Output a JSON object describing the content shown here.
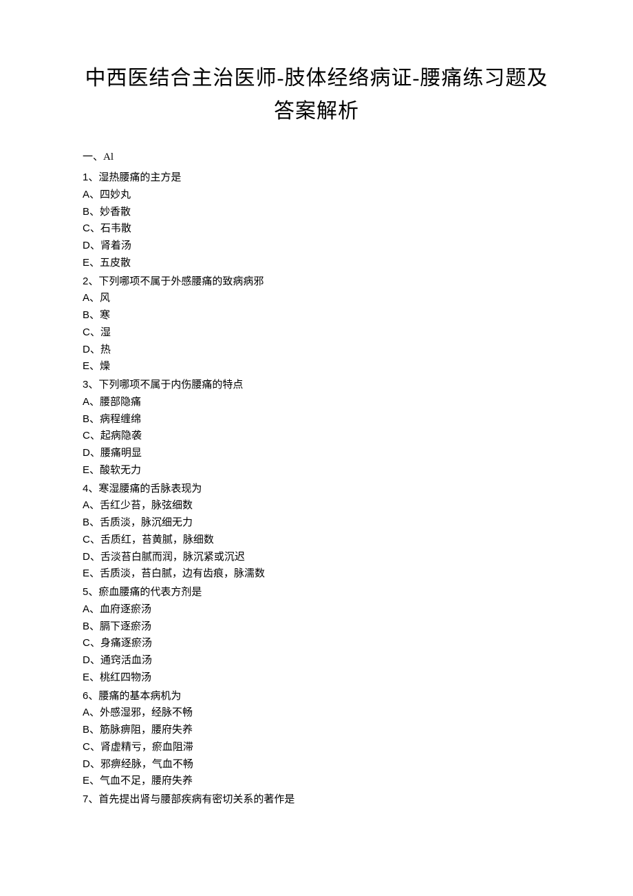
{
  "title": "中西医结合主治医师-肢体经络病证-腰痛练习题及答案解析",
  "section": "一、Al",
  "questions": [
    {
      "num": "1",
      "text": "湿热腰痛的主方是",
      "options": [
        {
          "letter": "A",
          "text": "四妙丸"
        },
        {
          "letter": "B",
          "text": "妙香散"
        },
        {
          "letter": "C",
          "text": "石韦散"
        },
        {
          "letter": "D",
          "text": "肾着汤"
        },
        {
          "letter": "E",
          "text": "五皮散"
        }
      ]
    },
    {
      "num": "2",
      "text": "下列哪项不属于外感腰痛的致病病邪",
      "options": [
        {
          "letter": "A",
          "text": "风"
        },
        {
          "letter": "B",
          "text": "寒"
        },
        {
          "letter": "C",
          "text": "湿"
        },
        {
          "letter": "D",
          "text": "热"
        },
        {
          "letter": "E",
          "text": "燥"
        }
      ]
    },
    {
      "num": "3",
      "text": "下列哪项不属于内伤腰痛的特点",
      "options": [
        {
          "letter": "A",
          "text": "腰部隐痛"
        },
        {
          "letter": "B",
          "text": "病程缠绵"
        },
        {
          "letter": "C",
          "text": "起病隐袭"
        },
        {
          "letter": "D",
          "text": "腰痛明显"
        },
        {
          "letter": "E",
          "text": "酸软无力"
        }
      ]
    },
    {
      "num": "4",
      "text": "寒湿腰痛的舌脉表现为",
      "options": [
        {
          "letter": "A",
          "text": "舌红少苔，脉弦细数"
        },
        {
          "letter": "B",
          "text": "舌质淡，脉沉细无力"
        },
        {
          "letter": "C",
          "text": "舌质红，苔黄腻，脉细数"
        },
        {
          "letter": "D",
          "text": "舌淡苔白腻而润，脉沉紧或沉迟"
        },
        {
          "letter": "E",
          "text": "舌质淡，苔白腻，边有齿痕，脉濡数"
        }
      ]
    },
    {
      "num": "5",
      "text": "瘀血腰痛的代表方剂是",
      "options": [
        {
          "letter": "A",
          "text": "血府逐瘀汤"
        },
        {
          "letter": "B",
          "text": "膈下逐瘀汤"
        },
        {
          "letter": "C",
          "text": "身痛逐瘀汤"
        },
        {
          "letter": "D",
          "text": "通窍活血汤"
        },
        {
          "letter": "E",
          "text": "桃红四物汤"
        }
      ]
    },
    {
      "num": "6",
      "text": "腰痛的基本病机为",
      "options": [
        {
          "letter": "A",
          "text": "外感湿邪，经脉不畅"
        },
        {
          "letter": "B",
          "text": "筋脉痹阻，腰府失养"
        },
        {
          "letter": "C",
          "text": "肾虚精亏，瘀血阻滞"
        },
        {
          "letter": "D",
          "text": "邪痹经脉，气血不畅"
        },
        {
          "letter": "E",
          "text": "气血不足，腰府失养"
        }
      ]
    },
    {
      "num": "7",
      "text": "首先提出肾与腰部疾病有密切关系的著作是",
      "options": []
    }
  ]
}
